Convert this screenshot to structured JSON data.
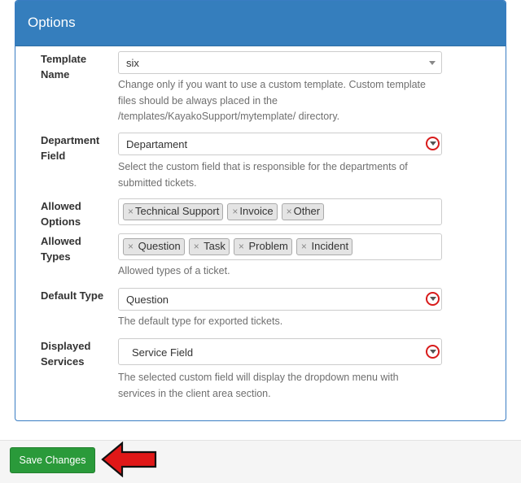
{
  "panel": {
    "title": "Options"
  },
  "template_name": {
    "label": "Template Name",
    "value": "six",
    "help": "Change only if you want to use a custom template. Custom template files should be always placed in the /templates/KayakoSupport/mytemplate/ directory."
  },
  "department_field": {
    "label": "Department Field",
    "value": "Departament",
    "help": "Select the custom field that is responsible for the departments of submitted tickets."
  },
  "allowed_options": {
    "label": "Allowed Options",
    "tags": [
      "Technical Support",
      "Invoice",
      "Other"
    ]
  },
  "allowed_types": {
    "label": "Allowed Types",
    "tags": [
      "Question",
      "Task",
      "Problem",
      "Incident"
    ],
    "help": "Allowed types of a ticket."
  },
  "default_type": {
    "label": "Default Type",
    "value": "Question",
    "help": "The default type for exported tickets."
  },
  "displayed_services": {
    "label": "Displayed Services",
    "value": "Service Field",
    "help": "The selected custom field will display the dropdown menu with services in the client area section."
  },
  "footer": {
    "save_label": "Save Changes"
  },
  "colors": {
    "header": "#357ebd",
    "save_button": "#2a9a3a",
    "highlight": "#d81b1b"
  }
}
